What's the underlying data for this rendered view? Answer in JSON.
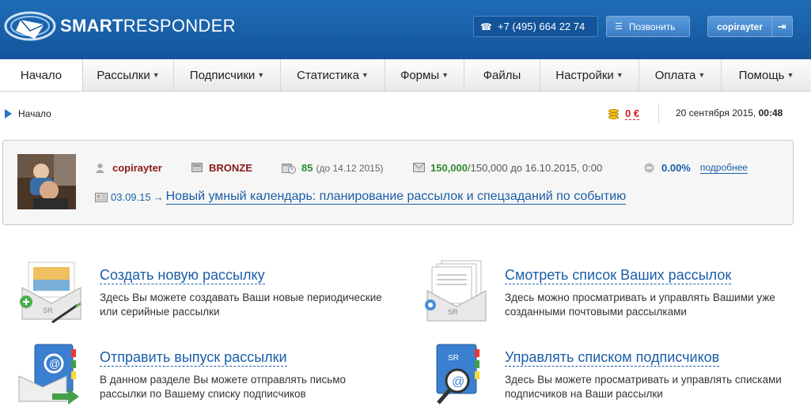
{
  "brand": {
    "name_bold": "SMART",
    "name_rest": "RESPONDER"
  },
  "header": {
    "phone": "+7 (495) 664 22 74",
    "call_label": "Позвонить",
    "username": "copirayter"
  },
  "nav": {
    "items": [
      {
        "label": "Начало",
        "caret": ""
      },
      {
        "label": "Рассылки",
        "caret": "▼"
      },
      {
        "label": "Подписчики",
        "caret": "▼"
      },
      {
        "label": "Статистика",
        "caret": "▼"
      },
      {
        "label": "Формы",
        "caret": "▼"
      },
      {
        "label": "Файлы",
        "caret": ""
      },
      {
        "label": "Настройки",
        "caret": "▼"
      },
      {
        "label": "Оплата",
        "caret": "▼"
      },
      {
        "label": "Помощь",
        "caret": "▼"
      }
    ]
  },
  "breadcrumb": {
    "current": "Начало"
  },
  "balance": {
    "amount": "0 €"
  },
  "datetime": {
    "date": "20 сентября 2015,",
    "time": "00:48"
  },
  "account": {
    "user": "copirayter",
    "plan": "BRONZE",
    "days": "85",
    "days_until": "(до 14.12 2015)",
    "letters_used": "150,000",
    "letters_total": "/150,000 до 16.10.2015, 0:00",
    "percent": "0.00%",
    "more": "подробнее"
  },
  "news": {
    "date": "03.09.15",
    "arrow": "→",
    "title": "Новый умный календарь: планирование рассылок и спецзаданий по событию"
  },
  "actions": [
    {
      "title": "Создать новую рассылку",
      "desc": "Здесь Вы можете создавать Ваши новые периодические или серийные рассылки"
    },
    {
      "title": "Смотреть список Ваших рассылок",
      "desc": "Здесь можно просматривать и управлять Вашими уже созданными почтовыми рассылками"
    },
    {
      "title": "Отправить выпуск рассылки",
      "desc": "В данном разделе Вы можете отправлять письмо рассылки по Вашему списку подписчиков"
    },
    {
      "title": "Управлять списком подписчиков",
      "desc": "Здесь Вы можете просматривать и управлять списками подписчиков на Ваши рассылки"
    }
  ],
  "icons": {
    "phone": "phone-icon",
    "call": "callback-icon",
    "logout": "logout-icon",
    "breadcrumb": "breadcrumb-arrow-icon",
    "balance": "coins-icon",
    "user": "user-icon",
    "plan": "plan-icon",
    "days": "calendar-icon",
    "letters": "envelope-icon",
    "percent": "minus-circle-icon",
    "news": "news-icon"
  },
  "colors": {
    "header": "#1a63ad",
    "link": "#1a5ea8",
    "accent_red": "#8b1a1a",
    "accent_green": "#2e8b2e"
  }
}
